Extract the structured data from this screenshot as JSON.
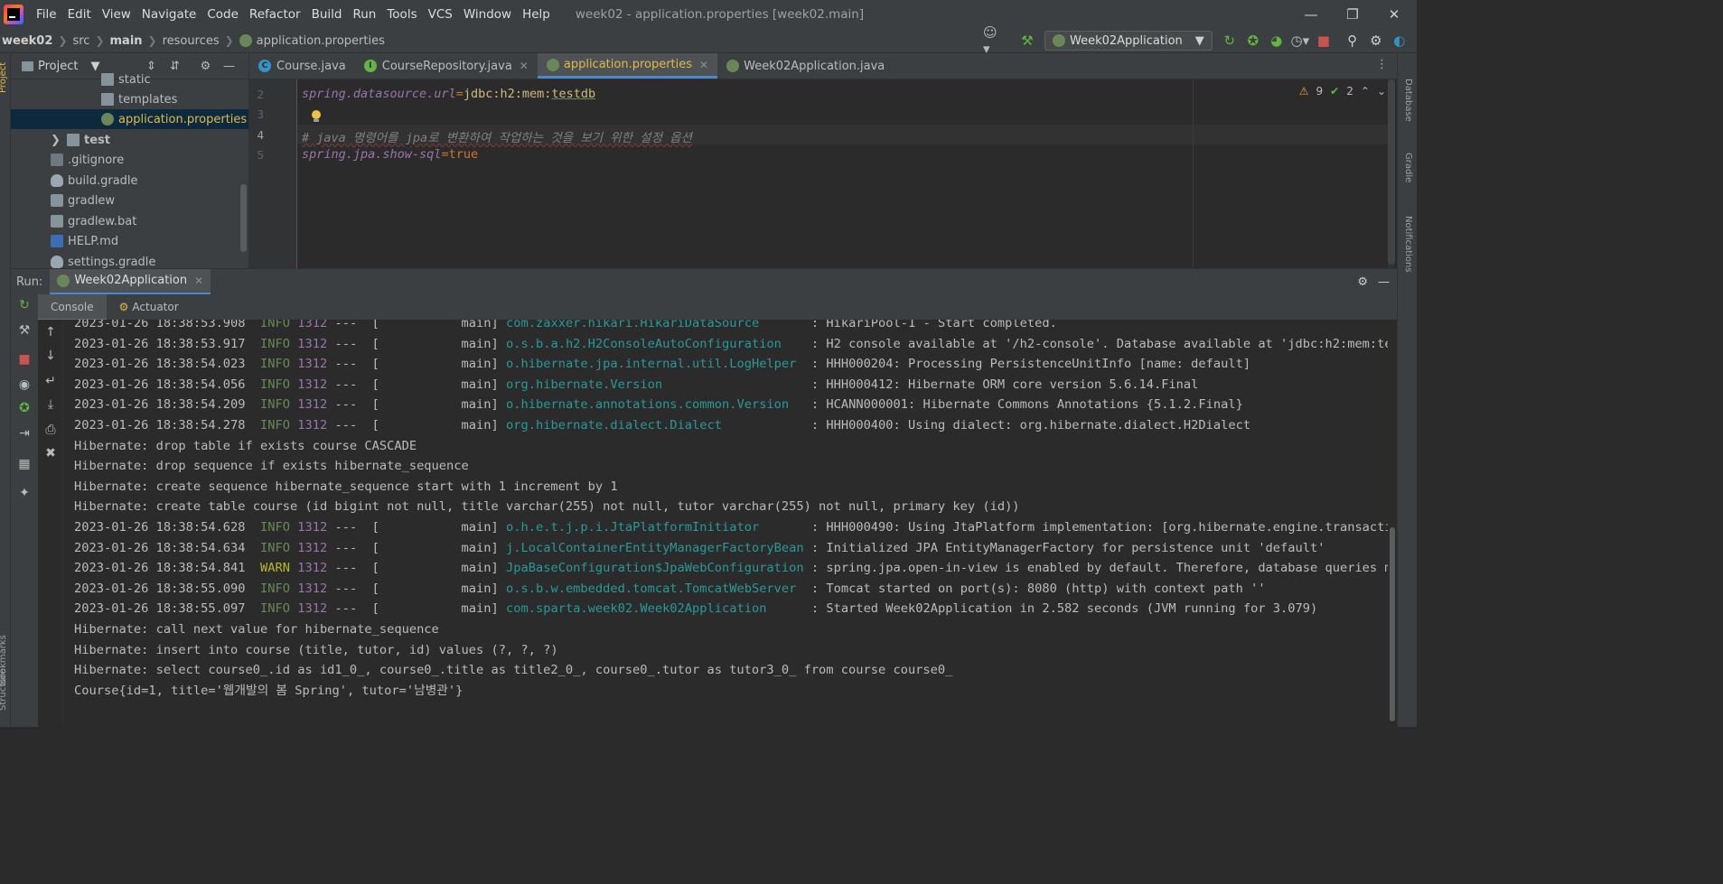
{
  "menubar": {
    "items": [
      "File",
      "Edit",
      "View",
      "Navigate",
      "Code",
      "Refactor",
      "Build",
      "Run",
      "Tools",
      "VCS",
      "Window",
      "Help"
    ],
    "window_title": "week02 - application.properties [week02.main]"
  },
  "breadcrumb": {
    "items": [
      "week02",
      "src",
      "main",
      "resources",
      "application.properties"
    ]
  },
  "run_config": {
    "label": "Week02Application"
  },
  "project_panel": {
    "title": "Project",
    "tree": [
      {
        "label": "static"
      },
      {
        "label": "templates"
      },
      {
        "label": "application.properties"
      },
      {
        "label": "test"
      },
      {
        "label": ".gitignore"
      },
      {
        "label": "build.gradle"
      },
      {
        "label": "gradlew"
      },
      {
        "label": "gradlew.bat"
      },
      {
        "label": "HELP.md"
      },
      {
        "label": "settings.gradle"
      }
    ]
  },
  "editor": {
    "tabs": [
      "Course.java",
      "CourseRepository.java",
      "application.properties",
      "Week02Application.java"
    ],
    "active_tab": "application.properties",
    "inspections": {
      "warnings": "9",
      "weak_warnings": "2"
    },
    "lines": [
      {
        "num": "2",
        "key": "spring.datasource.url",
        "value_prefix": "jdbc:h2:mem:",
        "value_link": "testdb"
      },
      {
        "num": "3"
      },
      {
        "num": "4",
        "comment": "# java 명령어를 jpa로 변환하여 작업하는 것을 보기 위한 설정 옵션"
      },
      {
        "num": "5",
        "key": "spring.jpa.show-sql",
        "value": "true"
      }
    ]
  },
  "right_stripe": [
    "Database",
    "Gradle",
    "Notifications"
  ],
  "left_stripe": [
    "Project",
    "Bookmarks",
    "Structure"
  ],
  "run_panel": {
    "label": "Run:",
    "tab": "Week02Application",
    "console_tabs": [
      "Console",
      "Actuator"
    ]
  },
  "console": {
    "lines": [
      {
        "ts": "2023-01-26 18:38:53.908",
        "level": "INFO",
        "pid": "1312",
        "thread": "---  [           main] ",
        "logger": "com.zaxxer.hikari.HikariDataSource      ",
        "msg": " : HikariPool-1 - Start completed."
      },
      {
        "ts": "2023-01-26 18:38:53.917",
        "level": "INFO",
        "pid": "1312",
        "thread": "---  [           main] ",
        "logger": "o.s.b.a.h2.H2ConsoleAutoConfiguration   ",
        "msg": " : H2 console available at '/h2-console'. Database available at 'jdbc:h2:mem:tes"
      },
      {
        "ts": "2023-01-26 18:38:54.023",
        "level": "INFO",
        "pid": "1312",
        "thread": "---  [           main] ",
        "logger": "o.hibernate.jpa.internal.util.LogHelper ",
        "msg": " : HHH000204: Processing PersistenceUnitInfo [name: default]"
      },
      {
        "ts": "2023-01-26 18:38:54.056",
        "level": "INFO",
        "pid": "1312",
        "thread": "---  [           main] ",
        "logger": "org.hibernate.Version                   ",
        "msg": " : HHH000412: Hibernate ORM core version 5.6.14.Final"
      },
      {
        "ts": "2023-01-26 18:38:54.209",
        "level": "INFO",
        "pid": "1312",
        "thread": "---  [           main] ",
        "logger": "o.hibernate.annotations.common.Version  ",
        "msg": " : HCANN000001: Hibernate Commons Annotations {5.1.2.Final}"
      },
      {
        "ts": "2023-01-26 18:38:54.278",
        "level": "INFO",
        "pid": "1312",
        "thread": "---  [           main] ",
        "logger": "org.hibernate.dialect.Dialect           ",
        "msg": " : HHH000400: Using dialect: org.hibernate.dialect.H2Dialect"
      },
      {
        "plain": "Hibernate: drop table if exists course CASCADE"
      },
      {
        "plain": "Hibernate: drop sequence if exists hibernate_sequence"
      },
      {
        "plain": "Hibernate: create sequence hibernate_sequence start with 1 increment by 1"
      },
      {
        "plain": "Hibernate: create table course (id bigint not null, title varchar(255) not null, tutor varchar(255) not null, primary key (id))"
      },
      {
        "ts": "2023-01-26 18:38:54.628",
        "level": "INFO",
        "pid": "1312",
        "thread": "---  [           main] ",
        "logger": "o.h.e.t.j.p.i.JtaPlatformInitiator      ",
        "msg": " : HHH000490: Using JtaPlatform implementation: [org.hibernate.engine.transactio"
      },
      {
        "ts": "2023-01-26 18:38:54.634",
        "level": "INFO",
        "pid": "1312",
        "thread": "---  [           main] ",
        "logger": "j.LocalContainerEntityManagerFactoryBean",
        "msg": " : Initialized JPA EntityManagerFactory for persistence unit 'default'"
      },
      {
        "ts": "2023-01-26 18:38:54.841",
        "level": "WARN",
        "pid": "1312",
        "thread": "---  [           main] ",
        "logger": "JpaBaseConfiguration$JpaWebConfiguration",
        "msg": " : spring.jpa.open-in-view is enabled by default. Therefore, database queries ma"
      },
      {
        "ts": "2023-01-26 18:38:55.090",
        "level": "INFO",
        "pid": "1312",
        "thread": "---  [           main] ",
        "logger": "o.s.b.w.embedded.tomcat.TomcatWebServer ",
        "msg": " : Tomcat started on port(s): 8080 (http) with context path ''"
      },
      {
        "ts": "2023-01-26 18:38:55.097",
        "level": "INFO",
        "pid": "1312",
        "thread": "---  [           main] ",
        "logger": "com.sparta.week02.Week02Application     ",
        "msg": " : Started Week02Application in 2.582 seconds (JVM running for 3.079)"
      },
      {
        "plain": "Hibernate: call next value for hibernate_sequence"
      },
      {
        "plain": "Hibernate: insert into course (title, tutor, id) values (?, ?, ?)"
      },
      {
        "plain": "Hibernate: select course0_.id as id1_0_, course0_.title as title2_0_, course0_.tutor as tutor3_0_ from course course0_"
      },
      {
        "plain": "Course{id=1, title='웹개발의 봄 Spring', tutor='남병관'}"
      }
    ]
  },
  "colors": {
    "accent": "#4a88c7",
    "info": "#6a8759",
    "warn": "#bbb529",
    "logger": "#299999",
    "pid": "#9876aa"
  },
  "icons": [
    "app-logo",
    "minimize-icon",
    "restore-icon",
    "close-icon",
    "user-icon",
    "hammer-icon",
    "rerun-icon",
    "debug-icon",
    "coverage-icon",
    "profile-icon",
    "stop-icon",
    "search-icon",
    "gear-icon",
    "folder-icon",
    "properties-icon",
    "gradle-icon",
    "lightbulb-icon"
  ]
}
